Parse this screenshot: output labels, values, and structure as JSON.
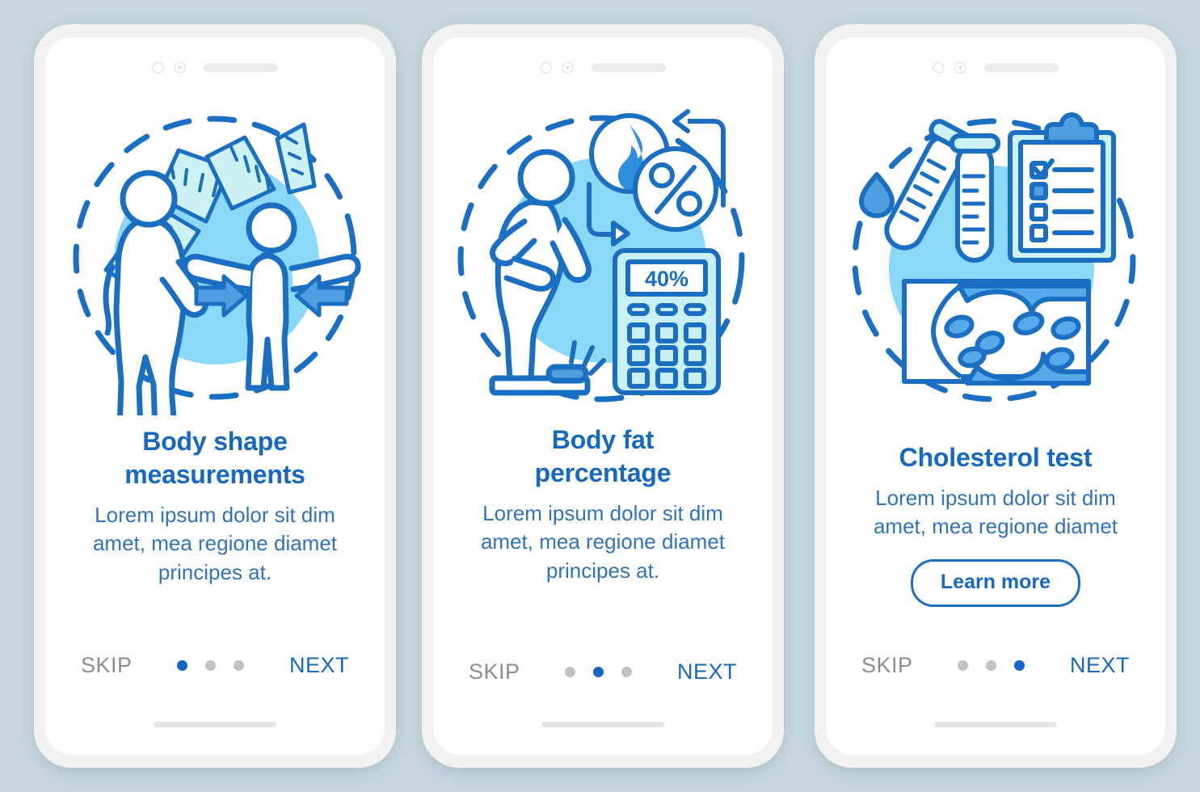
{
  "meta": {
    "background_color": "#c5d6de",
    "accent_color": "#1668c1",
    "muted_color": "#8d8d8d",
    "body_text_color": "#2f74bb",
    "circle_bg_color": "#8bd8f8",
    "tape_fill_color": "#ccf2f4",
    "arrow_fill_color": "#4f9fe0"
  },
  "screens": [
    {
      "id": "body-shape-measurements",
      "illustration_name": "body-shape-measurement-illustration",
      "title_lines": [
        "Body shape",
        "measurements"
      ],
      "description_lines": [
        "Lorem ipsum dolor sit dim",
        "amet, mea regione diamet",
        "principes at."
      ],
      "has_button": false,
      "button_label": "",
      "skip_label": "SKIP",
      "next_label": "NEXT",
      "dots": 3,
      "active_dot": 0
    },
    {
      "id": "body-fat-percentage",
      "illustration_name": "body-fat-percentage-illustration",
      "title_lines": [
        "Body fat",
        "percentage"
      ],
      "description_lines": [
        "Lorem ipsum dolor sit dim",
        "amet, mea regione diamet",
        "principes at."
      ],
      "has_button": false,
      "button_label": "",
      "calculator_display": "40%",
      "skip_label": "SKIP",
      "next_label": "NEXT",
      "dots": 3,
      "active_dot": 1
    },
    {
      "id": "cholesterol-test",
      "illustration_name": "cholesterol-test-illustration",
      "title_lines": [
        "Cholesterol test"
      ],
      "description_lines": [
        "Lorem ipsum dolor sit dim",
        "amet, mea regione diamet"
      ],
      "has_button": true,
      "button_label": "Learn more",
      "skip_label": "SKIP",
      "next_label": "NEXT",
      "dots": 3,
      "active_dot": 2
    }
  ]
}
